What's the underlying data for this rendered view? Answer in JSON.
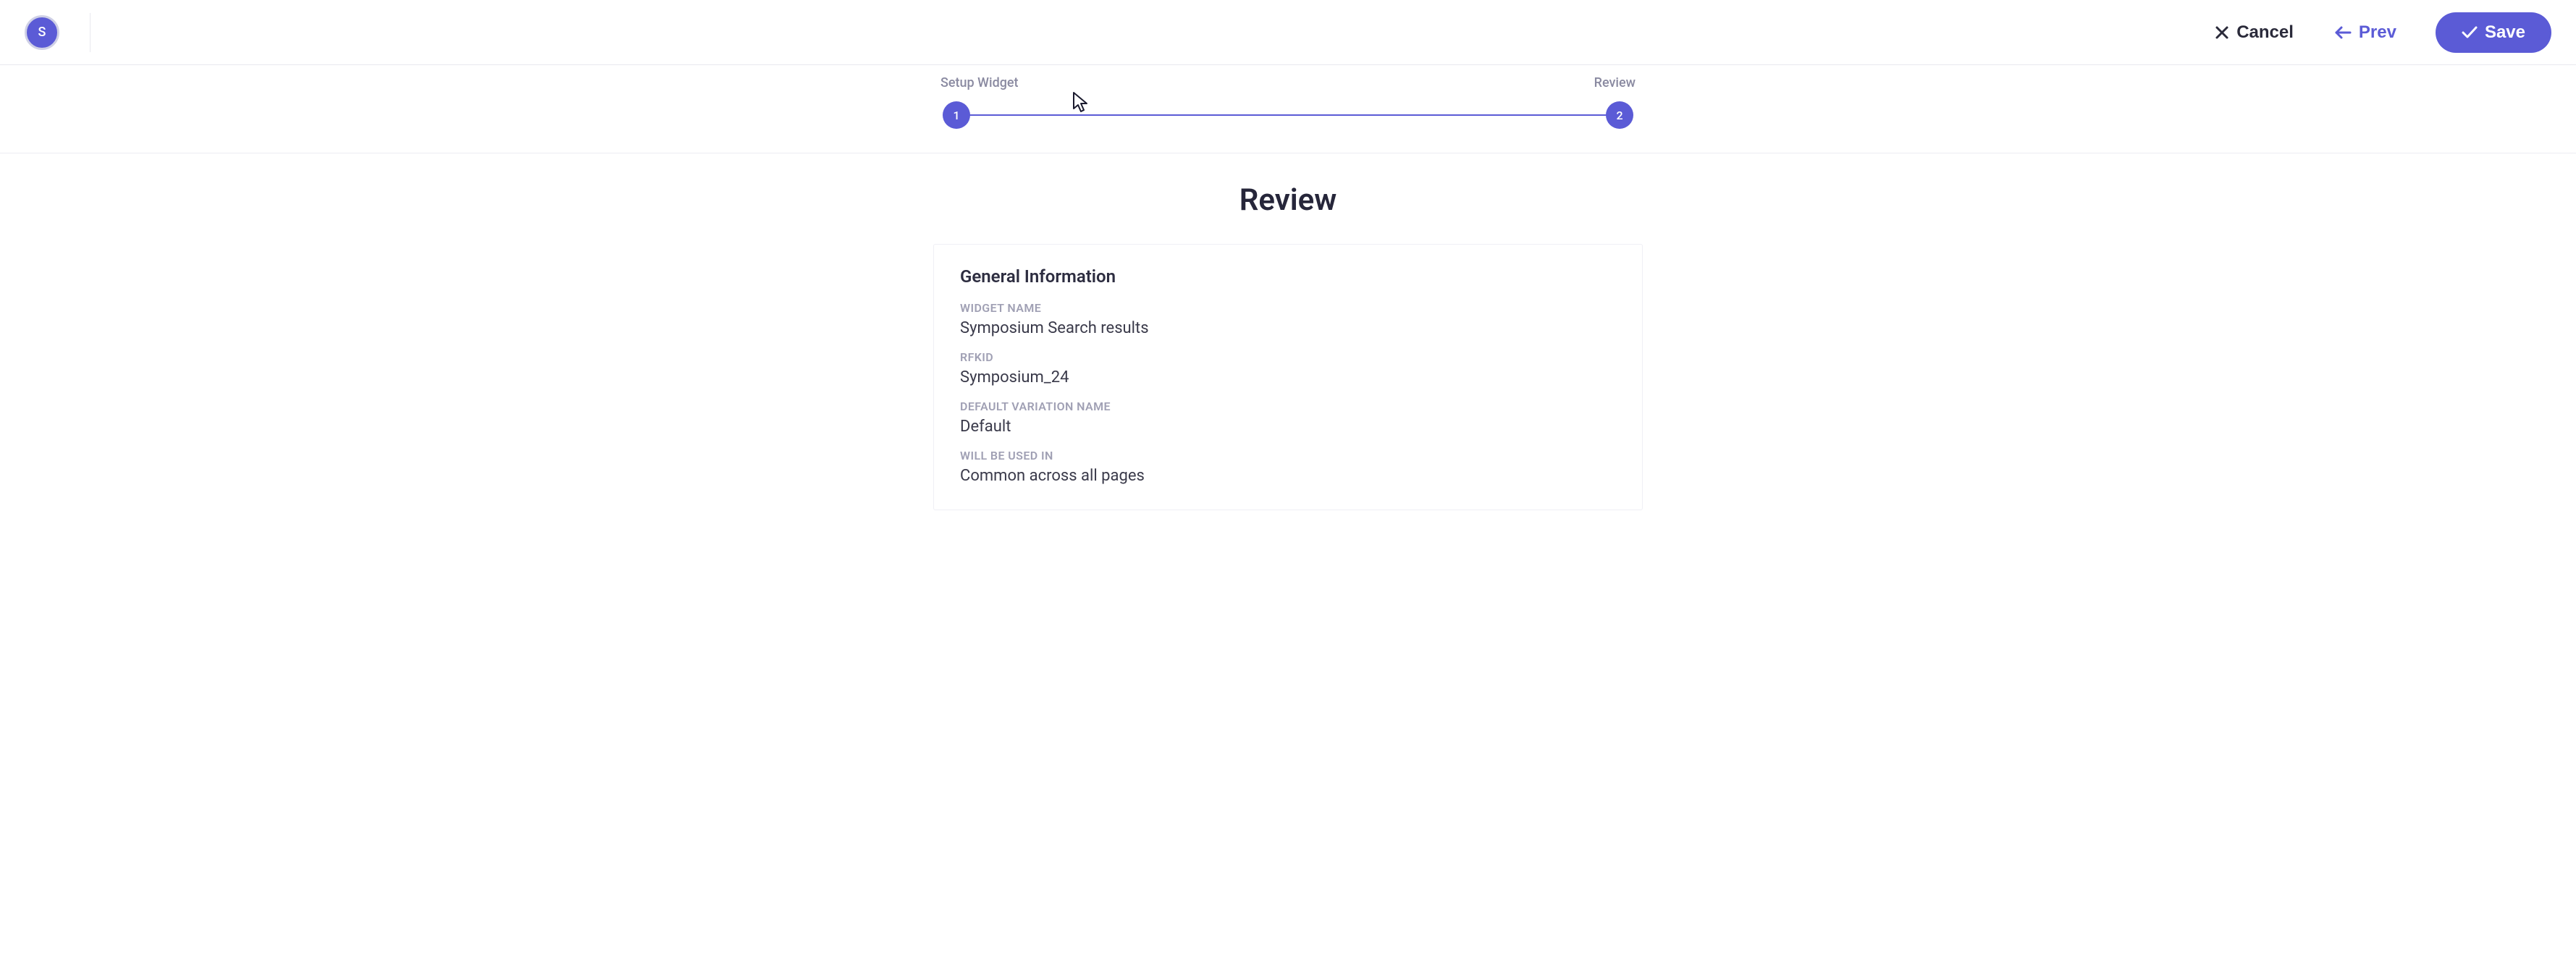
{
  "avatar": {
    "letter": "S"
  },
  "actions": {
    "cancel": "Cancel",
    "prev": "Prev",
    "save": "Save"
  },
  "stepper": {
    "steps": [
      {
        "label": "Setup Widget",
        "num": "1"
      },
      {
        "label": "Review",
        "num": "2"
      }
    ]
  },
  "page": {
    "heading": "Review"
  },
  "card": {
    "title": "General Information",
    "fields": {
      "widget_name": {
        "label": "WIDGET NAME",
        "value": "Symposium Search results"
      },
      "rfkid": {
        "label": "RFKID",
        "value": "Symposium_24"
      },
      "default_variation": {
        "label": "DEFAULT VARIATION NAME",
        "value": "Default"
      },
      "used_in": {
        "label": "WILL BE USED IN",
        "value": "Common across all pages"
      }
    }
  }
}
